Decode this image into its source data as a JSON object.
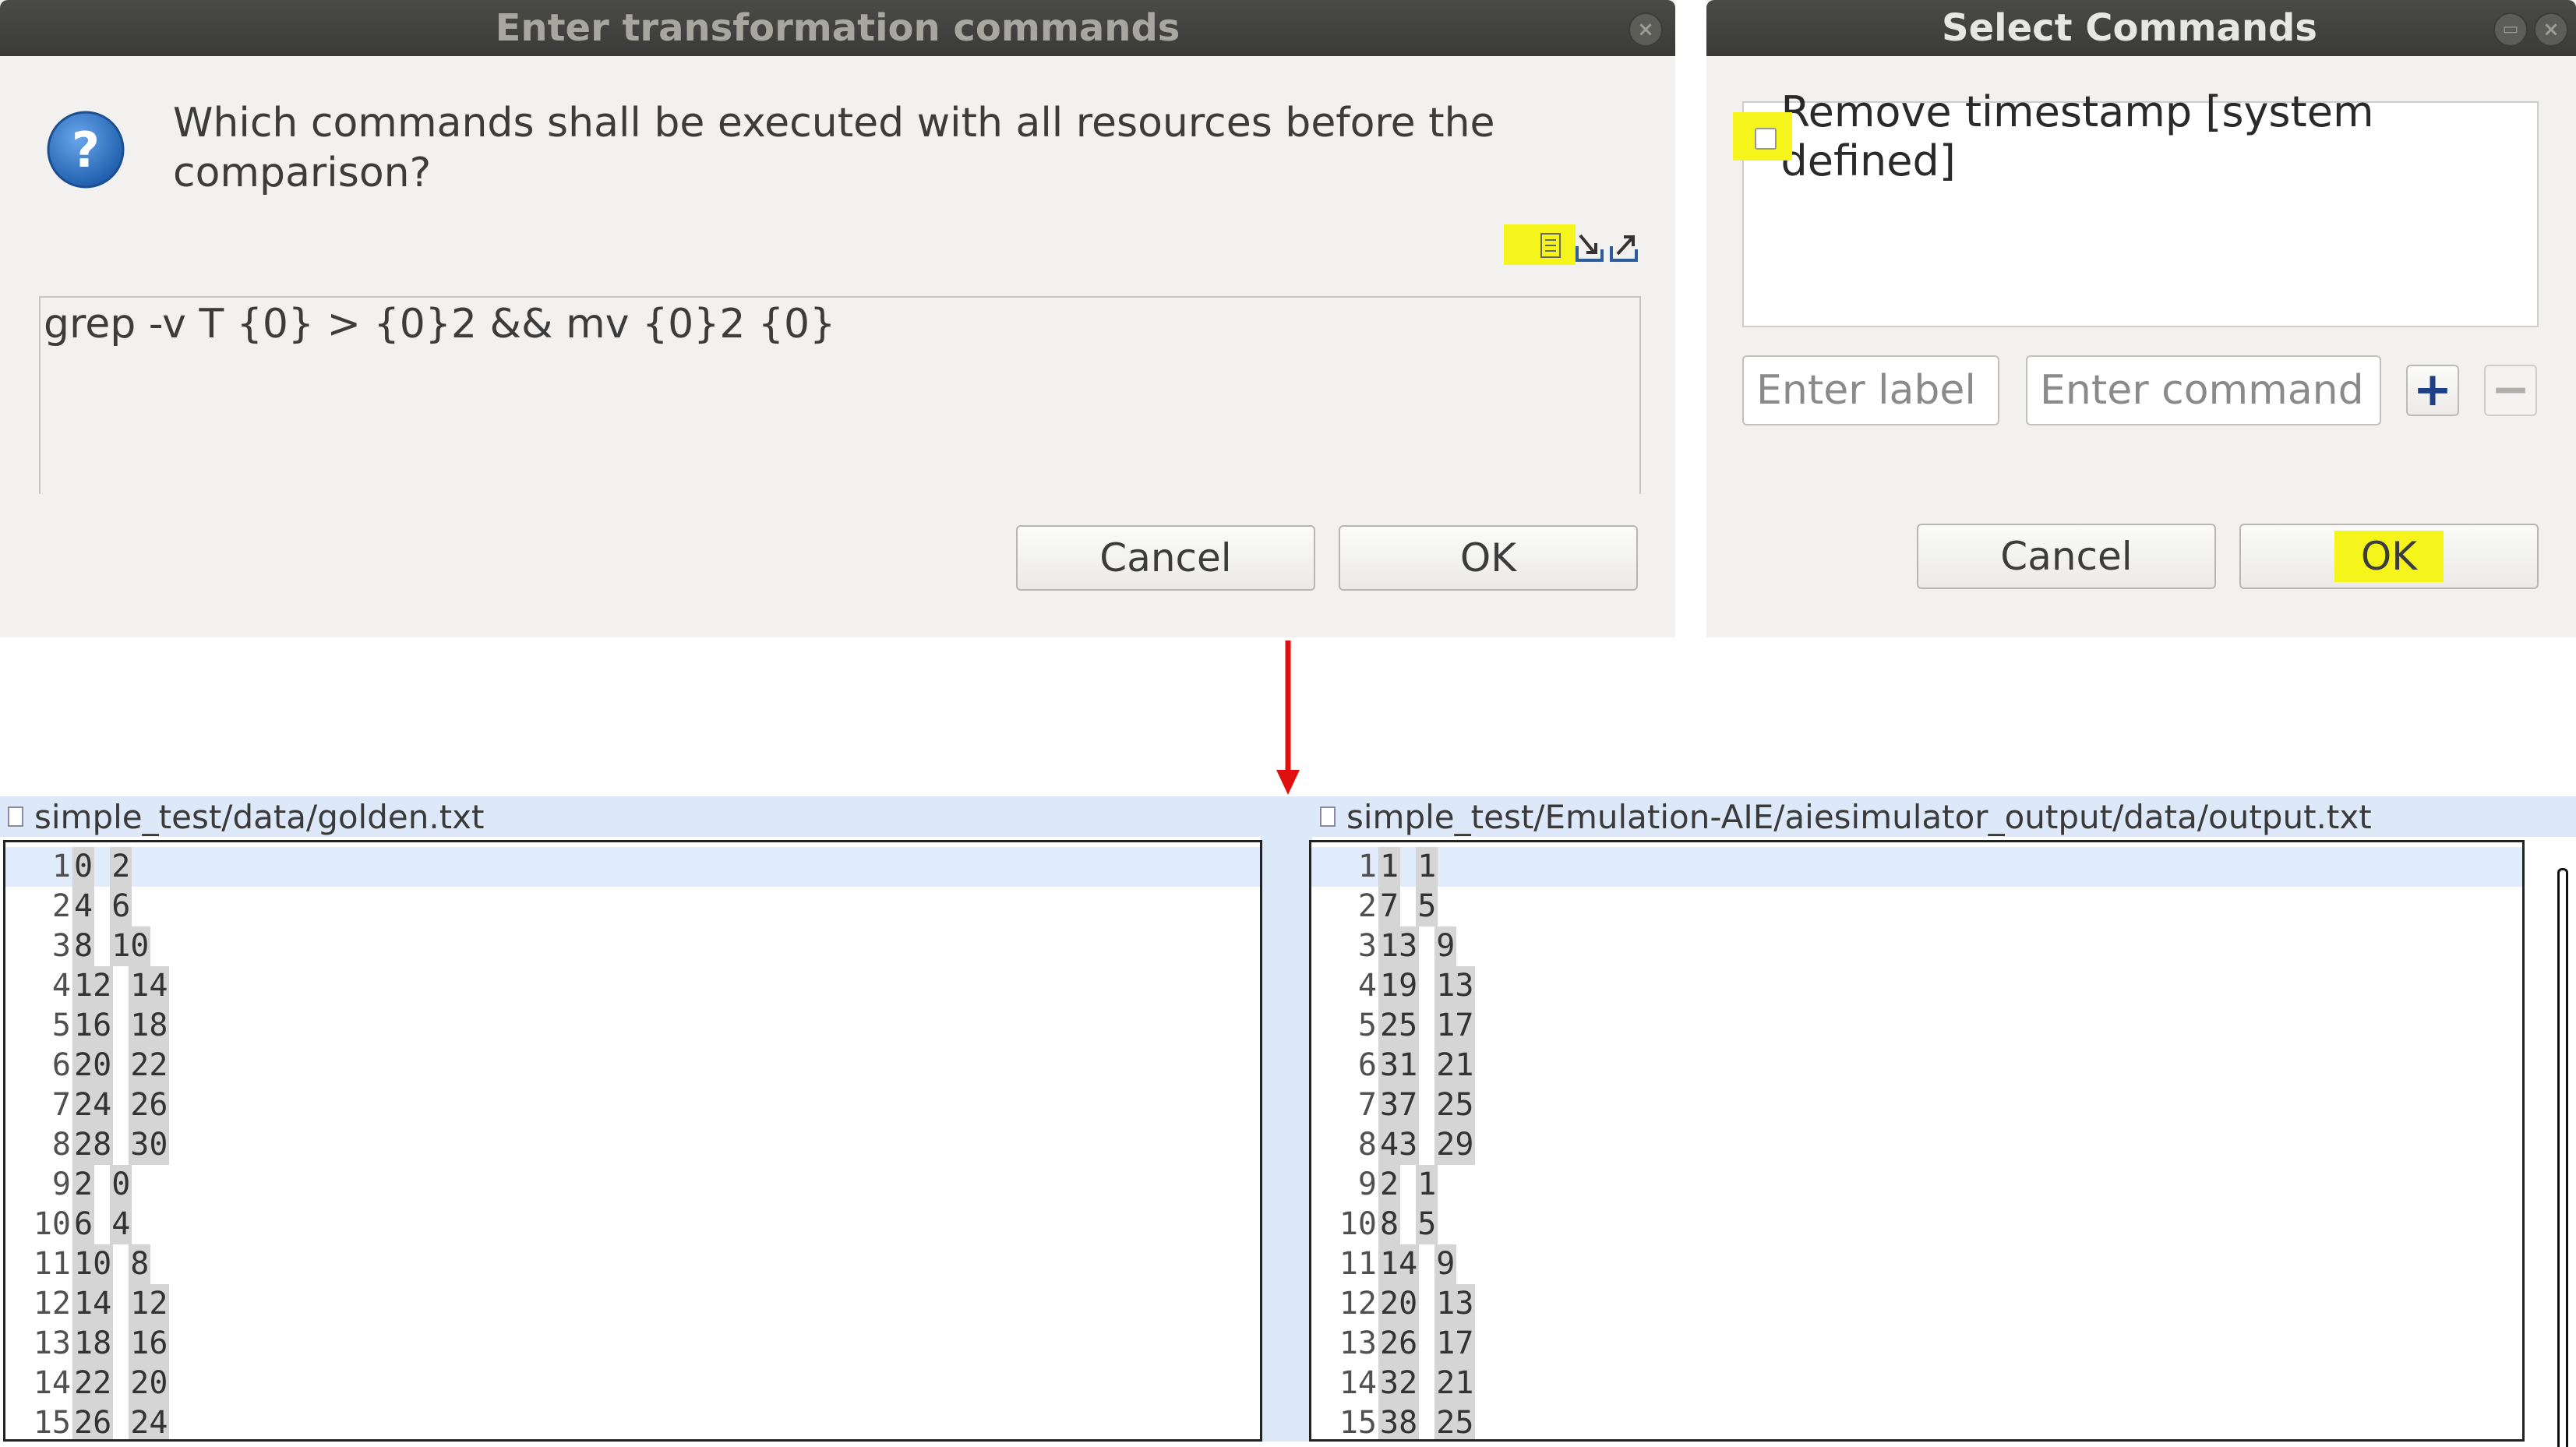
{
  "dialog_transform": {
    "title": "Enter transformation commands",
    "question": "Which commands shall be executed with all resources before the comparison?",
    "command_text": "grep -v T {0} > {0}2 && mv {0}2 {0}",
    "cancel_label": "Cancel",
    "ok_label": "OK",
    "close_glyph": "×"
  },
  "dialog_select": {
    "title": "Select Commands",
    "option_label": "Remove timestamp [system defined]",
    "option_checked": false,
    "label_placeholder": "Enter label",
    "command_placeholder": "Enter command",
    "add_glyph": "+",
    "remove_glyph": "−",
    "cancel_label": "Cancel",
    "ok_label": "OK"
  },
  "diff": {
    "left": {
      "path": "simple_test/data/golden.txt",
      "rows": [
        {
          "n": "1",
          "a": "0",
          "b": "2"
        },
        {
          "n": "2",
          "a": "4",
          "b": "6"
        },
        {
          "n": "3",
          "a": "8",
          "b": "10"
        },
        {
          "n": "4",
          "a": "12",
          "b": "14"
        },
        {
          "n": "5",
          "a": "16",
          "b": "18"
        },
        {
          "n": "6",
          "a": "20",
          "b": "22"
        },
        {
          "n": "7",
          "a": "24",
          "b": "26"
        },
        {
          "n": "8",
          "a": "28",
          "b": "30"
        },
        {
          "n": "9",
          "a": "2",
          "b": "0"
        },
        {
          "n": "10",
          "a": "6",
          "b": "4"
        },
        {
          "n": "11",
          "a": "10",
          "b": "8"
        },
        {
          "n": "12",
          "a": "14",
          "b": "12"
        },
        {
          "n": "13",
          "a": "18",
          "b": "16"
        },
        {
          "n": "14",
          "a": "22",
          "b": "20"
        },
        {
          "n": "15",
          "a": "26",
          "b": "24"
        }
      ]
    },
    "right": {
      "path": "simple_test/Emulation-AIE/aiesimulator_output/data/output.txt",
      "rows": [
        {
          "n": "1",
          "a": "1",
          "b": "1"
        },
        {
          "n": "2",
          "a": "7",
          "b": "5"
        },
        {
          "n": "3",
          "a": "13",
          "b": "9"
        },
        {
          "n": "4",
          "a": "19",
          "b": "13"
        },
        {
          "n": "5",
          "a": "25",
          "b": "17"
        },
        {
          "n": "6",
          "a": "31",
          "b": "21"
        },
        {
          "n": "7",
          "a": "37",
          "b": "25"
        },
        {
          "n": "8",
          "a": "43",
          "b": "29"
        },
        {
          "n": "9",
          "a": "2",
          "b": "1"
        },
        {
          "n": "10",
          "a": "8",
          "b": "5"
        },
        {
          "n": "11",
          "a": "14",
          "b": "9"
        },
        {
          "n": "12",
          "a": "20",
          "b": "13"
        },
        {
          "n": "13",
          "a": "26",
          "b": "17"
        },
        {
          "n": "14",
          "a": "32",
          "b": "21"
        },
        {
          "n": "15",
          "a": "38",
          "b": "25"
        }
      ]
    }
  },
  "colors": {
    "highlight": "#f5f51b",
    "arrow": "#e01010",
    "header_bg": "#dde9f9",
    "question_icon": "#2a6fc0"
  },
  "icons": [
    "question-icon",
    "list-icon",
    "import-icon",
    "export-icon",
    "close-icon",
    "add-icon",
    "remove-icon",
    "file-icon"
  ]
}
